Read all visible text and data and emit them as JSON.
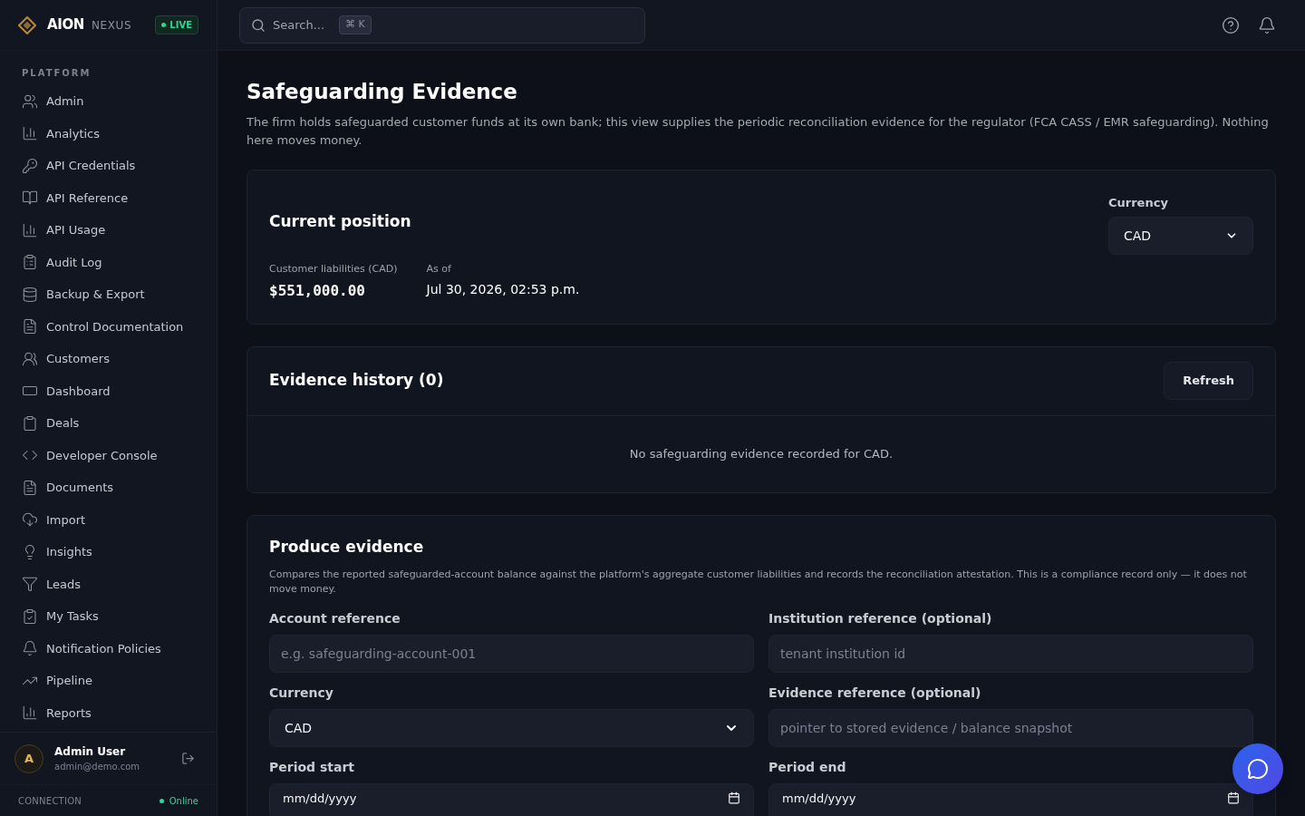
{
  "brand": {
    "name": "AION",
    "suffix": "NEXUS",
    "badge": "LIVE"
  },
  "sidebar": {
    "section": "PLATFORM",
    "items": [
      {
        "label": "Admin"
      },
      {
        "label": "Analytics"
      },
      {
        "label": "API Credentials"
      },
      {
        "label": "API Reference"
      },
      {
        "label": "API Usage"
      },
      {
        "label": "Audit Log"
      },
      {
        "label": "Backup & Export"
      },
      {
        "label": "Control Documentation"
      },
      {
        "label": "Customers"
      },
      {
        "label": "Dashboard"
      },
      {
        "label": "Deals"
      },
      {
        "label": "Developer Console"
      },
      {
        "label": "Documents"
      },
      {
        "label": "Import"
      },
      {
        "label": "Insights"
      },
      {
        "label": "Leads"
      },
      {
        "label": "My Tasks"
      },
      {
        "label": "Notification Policies"
      },
      {
        "label": "Pipeline"
      },
      {
        "label": "Reports"
      }
    ],
    "user": {
      "initial": "A",
      "name": "Admin User",
      "email": "admin@demo.com"
    },
    "connection": {
      "label": "CONNECTION",
      "status": "Online"
    }
  },
  "search": {
    "placeholder": "Search...",
    "shortcut": "⌘ K"
  },
  "page": {
    "title": "Safeguarding Evidence",
    "description": "The firm holds safeguarded customer funds at its own bank; this view supplies the periodic reconciliation evidence for the regulator (FCA CASS / EMR safeguarding). Nothing here moves money."
  },
  "position": {
    "title": "Current position",
    "currency_label": "Currency",
    "currency": "CAD",
    "liabilities_label": "Customer liabilities (CAD)",
    "liabilities": "$551,000.00",
    "as_of_label": "As of",
    "as_of": "Jul 30, 2026, 02:53 p.m."
  },
  "history": {
    "title": "Evidence history (0)",
    "refresh": "Refresh",
    "empty": "No safeguarding evidence recorded for CAD."
  },
  "produce": {
    "title": "Produce evidence",
    "description": "Compares the reported safeguarded-account balance against the platform's aggregate customer liabilities and records the reconciliation attestation. This is a compliance record only — it does not move money.",
    "fields": [
      {
        "kind": "text",
        "label": "Account reference",
        "placeholder": "e.g. safeguarding-account-001"
      },
      {
        "kind": "text",
        "label": "Institution reference (optional)",
        "placeholder": "tenant institution id"
      },
      {
        "kind": "select",
        "label": "Currency",
        "value": "CAD"
      },
      {
        "kind": "text",
        "label": "Evidence reference (optional)",
        "placeholder": "pointer to stored evidence / balance snapshot"
      },
      {
        "kind": "date",
        "label": "Period start",
        "value": "mm/dd/yyyy"
      },
      {
        "kind": "date",
        "label": "Period end",
        "value": "mm/dd/yyyy"
      }
    ]
  }
}
